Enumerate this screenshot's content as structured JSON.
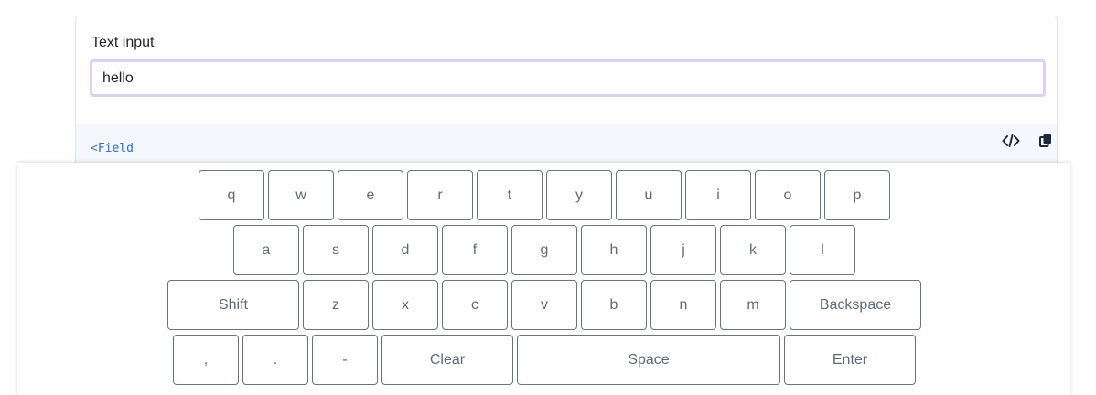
{
  "field": {
    "label": "Text input",
    "value": "hello"
  },
  "code": {
    "snippet_open": "<",
    "snippet_tag": "Field",
    "view_code_icon": "code-icon",
    "copy_icon": "copy-icon"
  },
  "keyboard": {
    "row1": [
      "q",
      "w",
      "e",
      "r",
      "t",
      "y",
      "u",
      "i",
      "o",
      "p"
    ],
    "row2": [
      "a",
      "s",
      "d",
      "f",
      "g",
      "h",
      "j",
      "k",
      "l"
    ],
    "row3": [
      "Shift",
      "z",
      "x",
      "c",
      "v",
      "b",
      "n",
      "m",
      "Backspace"
    ],
    "row4": [
      ",",
      ".",
      "-",
      "Clear",
      "Space",
      "Enter"
    ]
  },
  "colors": {
    "input_focus_border": "#dcd0f5",
    "key_border": "#6b7280",
    "key_text": "#5f6b7a",
    "code_strip_bg": "#f4f7fb"
  }
}
